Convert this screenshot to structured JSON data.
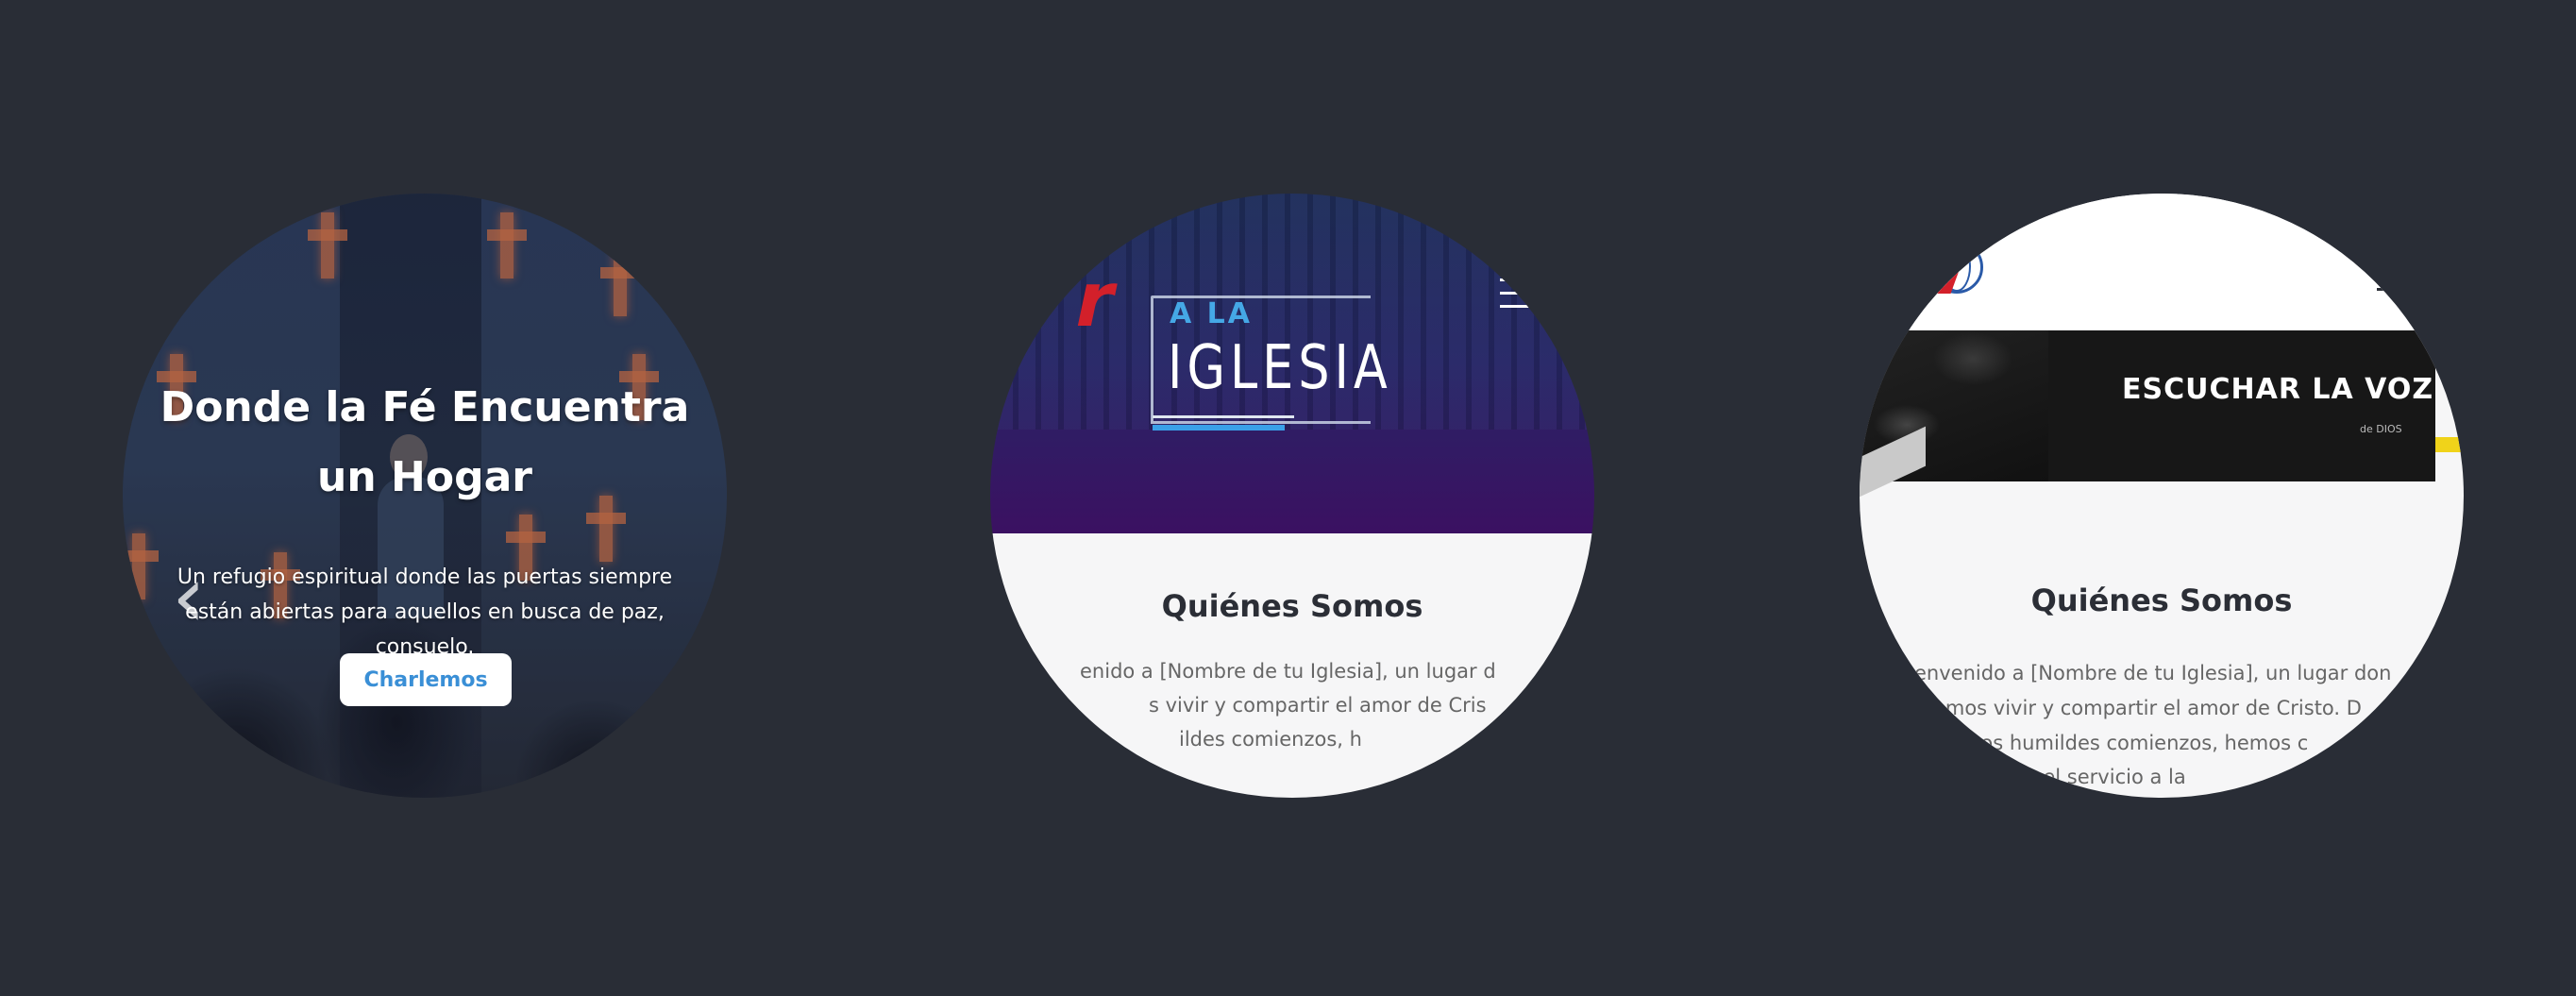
{
  "background_color": "#292d36",
  "slides": [
    {
      "hero": {
        "title": "Donde la Fé Encuentra un Hogar",
        "subtitle": "Un refugio espiritual donde las puertas siempre están abiertas para aquellos en busca de paz, consuelo.",
        "button_label": "Charlemos",
        "prev_arrow": "‹"
      }
    },
    {
      "logo": {
        "small_text": "A LA",
        "big_text": "IGLESIA",
        "brand_mark": "r"
      },
      "menu_icon": "hamburger-icon",
      "about": {
        "title": "Quiénes Somos",
        "lines": [
          "enido a [Nombre de tu Iglesia], un lugar d",
          "s vivir y compartir el amor de Cris",
          "ildes comienzos, h"
        ]
      }
    },
    {
      "banner": {
        "text": "ESCUCHAR LA VOZ",
        "subtext": "de DIOS"
      },
      "about": {
        "title": "Quiénes Somos",
        "lines": [
          "envenido a [Nombre de tu Iglesia], un lugar don",
          "amos vivir y compartir el amor de Cristo. D",
          "tros humildes comienzos, hemos c",
          "con el servicio a la"
        ]
      }
    }
  ]
}
